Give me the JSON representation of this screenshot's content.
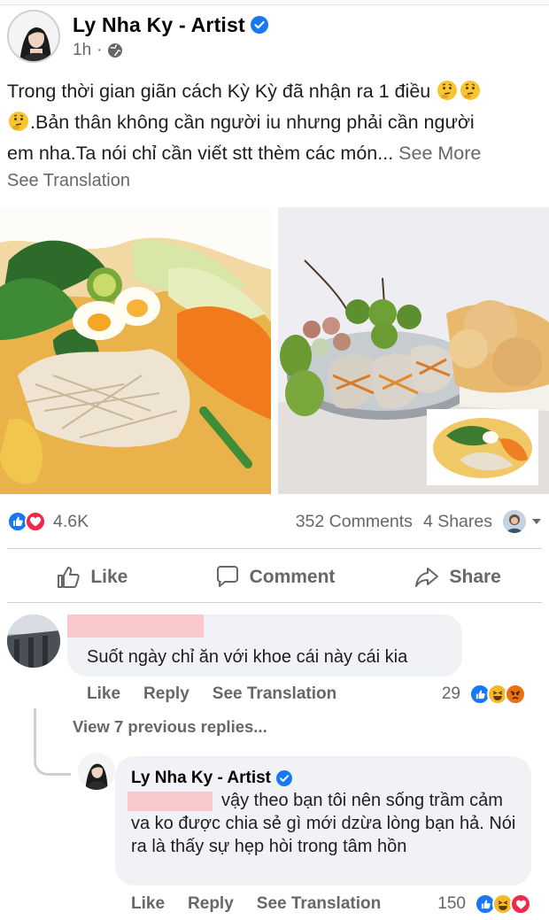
{
  "post": {
    "author": "Ly Nha Ky - Artist",
    "time": "1h",
    "text_line1": "Trong thời gian giãn cách Kỳ Kỳ đã nhận ra 1 điều",
    "text_line2": ".Bản thân không cần người iu nhưng phải cần người",
    "text_line3": "em nha.Ta nói chỉ cần viết stt thèm các món...",
    "see_more": "See More",
    "see_translation": "See Translation"
  },
  "stats": {
    "reaction_count": "4.6K",
    "comments": "352 Comments",
    "shares": "4 Shares"
  },
  "actions": {
    "like": "Like",
    "comment": "Comment",
    "share": "Share"
  },
  "comment1": {
    "text": "Suốt ngày chỉ ăn với khoe cái này cái kia",
    "like": "Like",
    "reply": "Reply",
    "see_translation": "See Translation",
    "reaction_count": "29"
  },
  "view_previous": "View 7 previous replies...",
  "reply1": {
    "author": "Ly Nha Ky - Artist",
    "text": "vậy theo bạn tôi nên sống trầm cảm va ko được chia sẻ gì mới dzừa lòng bạn hả. Nói ra là thấy sự hẹp hòi trong tâm hồn",
    "like": "Like",
    "reply": "Reply",
    "see_translation": "See Translation",
    "reaction_count": "150"
  },
  "colors": {
    "facebook_blue": "#1877f2",
    "love_red": "#f0284a",
    "haha_yellow": "#f7b928",
    "angry_orange": "#e9710f",
    "redaction_pink": "#f8c8cc"
  }
}
